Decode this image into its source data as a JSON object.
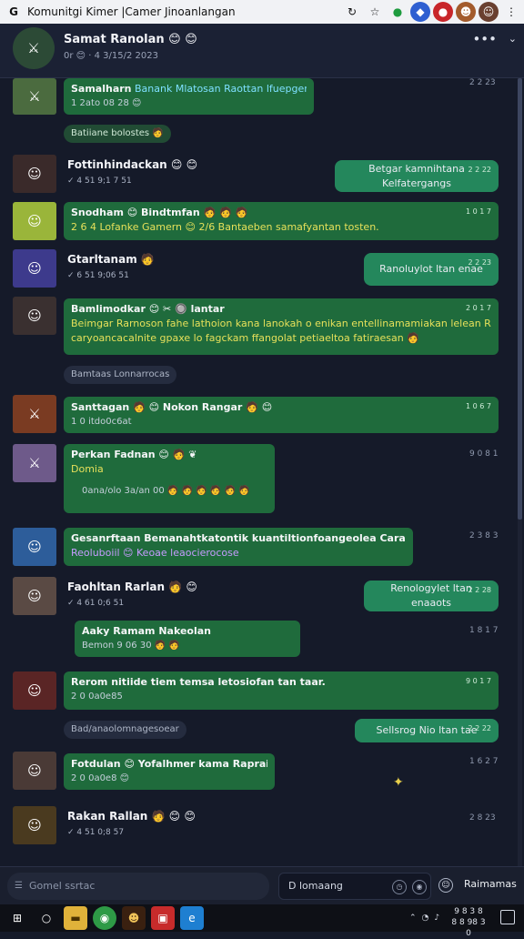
{
  "window": {
    "title": "Komunitgi Kimer |Camer Jinoanlangan"
  },
  "header": {
    "name": "Samat Ranolan 😊 😊",
    "status": "0r 😊 · 4 3/15/2 2023",
    "menu": "•••",
    "chev": "⌄"
  },
  "messages": [
    {
      "name": "Samalharn",
      "body": "Banank Mlatosan  Raottan lfuepgensar. 🧑",
      "sub": "1 2ato 08 28 😊",
      "time": "2 2 23"
    },
    {
      "name": "Fottinhindackan 😊 😊",
      "sub": "✓ 4 51 9;1 7 51",
      "reply": "Betgar kamnihtana Kelfatergangs",
      "reply_time": "2 2 22"
    },
    {
      "name": "Snodham 😊  Bindtmfan 🧑 🧑 🧑",
      "body": "2 6 4 Lofanke Gamern 😊 2/6  Bantaeben samafyantan tosten.",
      "time": "1 0 1 7"
    },
    {
      "name": "Gtarltanam 🧑",
      "sub": "✓ 6 51 9;06 51",
      "reply": "Ranoluylot ltan enae",
      "reply_time": "2 2 23"
    },
    {
      "name": "Bamlimodkar 😊 ✂ 🔘 lantar",
      "body": "Beimgar Rarnoson fahe  lathoion kana lanokah o enikan entellinamamiakan  lelean Rao",
      "body2": "caryoancacalnite gpaxe  lo fagckam  ffangolat petiaeltoa fatiraesan 🧑",
      "time": "2 0 1 7"
    },
    {
      "name": "Santtagan 🧑 😊 Nokon Rangar 🧑 😊",
      "sub": "1 0 itdo0c6at",
      "time": "1 0 6 7"
    },
    {
      "name": "Perkan Fadnan 😊 🧑 ❦",
      "body": "Domia",
      "sub": "0ana/olo 3a/an 00 🧑 🧑 🧑 🧑 🧑 🧑",
      "time": "9 0 8 1"
    },
    {
      "name": "Gesanrftaan Bemanahtkatontik kuantiltionfoangeolea  Caraidciebkaul:",
      "body": "Reoluboiil 😊 Keoae leaocierocose",
      "time": "2 3 8 3"
    },
    {
      "name": "Faohltan Rarlan 🧑 😊",
      "sub": "✓ 4 61 0;6 51",
      "reply": "Renologylet ltan enaaots",
      "reply_time": "2 2 28"
    },
    {
      "name": "Aaky Ramam Nakeolan",
      "sub": "Bemon 9 06 30 🧑 🧑",
      "time": "1 8 1 7"
    },
    {
      "name": "Rerom nitiide tiem temsa letosiofan tan taar.",
      "sub": "2 0 0a0e85",
      "time": "9 0 1 7"
    },
    {
      "name": "Fotdulan 😊 Yofalhmer kama Raprain 🧑",
      "sub": "2 0 0a0e8 😊",
      "time": "1 6 2 7"
    },
    {
      "name": "Rakan Rallan 🧑 😊 😊",
      "sub": "✓ 4 51 0;8 57",
      "time": "2 8 23"
    }
  ],
  "pills": [
    {
      "text": "Batiiane  bolostes 🧑"
    },
    {
      "text": "Bamtaas Lonnarrocas"
    },
    {
      "text": "Bad/anaolomnagesoear"
    }
  ],
  "outgoing_last": {
    "text": "Sellsrog Nio ltan tae",
    "time": "2 2 22"
  },
  "composer": {
    "left_label": "Gomel ssrtac",
    "input_value": "D lomaang",
    "send_label": "Raimamas"
  },
  "taskbar": {
    "clock_time": "9 8 3 8",
    "clock_date": "8 8 98 3 0"
  }
}
